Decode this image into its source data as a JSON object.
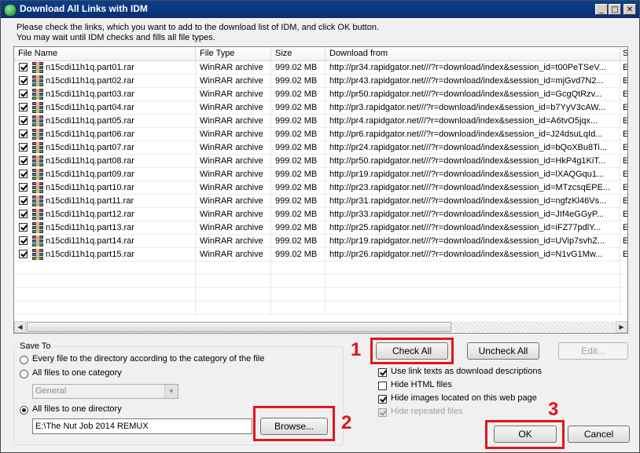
{
  "window": {
    "title": "Download All Links with IDM"
  },
  "instructions": [
    "Please check the links, which you want to add to the download list of IDM, and click OK button.",
    "You may wait until IDM checks and fills all file types."
  ],
  "columns": {
    "name": "File Name",
    "type": "File Type",
    "size": "Size",
    "from": "Download from",
    "extra": "S"
  },
  "files": [
    {
      "name": "n15cdi11h1q.part01.rar",
      "type": "WinRAR archive",
      "size": "999.02  MB",
      "url": "http://pr34.rapidgator.net///?r=download/index&session_id=t00PeTSeV...",
      "extra": "E"
    },
    {
      "name": "n15cdi11h1q.part02.rar",
      "type": "WinRAR archive",
      "size": "999.02  MB",
      "url": "http://pr43.rapidgator.net///?r=download/index&session_id=mjGvd7N2...",
      "extra": "E"
    },
    {
      "name": "n15cdi11h1q.part03.rar",
      "type": "WinRAR archive",
      "size": "999.02  MB",
      "url": "http://pr50.rapidgator.net///?r=download/index&session_id=GcgQtRzv...",
      "extra": "E"
    },
    {
      "name": "n15cdi11h1q.part04.rar",
      "type": "WinRAR archive",
      "size": "999.02  MB",
      "url": "http://pr3.rapidgator.net///?r=download/index&session_id=b7YyV3cAW...",
      "extra": "E"
    },
    {
      "name": "n15cdi11h1q.part05.rar",
      "type": "WinRAR archive",
      "size": "999.02  MB",
      "url": "http://pr4.rapidgator.net///?r=download/index&session_id=A6tvO5jqx...",
      "extra": "E"
    },
    {
      "name": "n15cdi11h1q.part06.rar",
      "type": "WinRAR archive",
      "size": "999.02  MB",
      "url": "http://pr6.rapidgator.net///?r=download/index&session_id=J24dsuLqId...",
      "extra": "E"
    },
    {
      "name": "n15cdi11h1q.part07.rar",
      "type": "WinRAR archive",
      "size": "999.02  MB",
      "url": "http://pr24.rapidgator.net///?r=download/index&session_id=bQoXBu8Ti...",
      "extra": "E"
    },
    {
      "name": "n15cdi11h1q.part08.rar",
      "type": "WinRAR archive",
      "size": "999.02  MB",
      "url": "http://pr50.rapidgator.net///?r=download/index&session_id=HkP4g1KiT...",
      "extra": "E"
    },
    {
      "name": "n15cdi11h1q.part09.rar",
      "type": "WinRAR archive",
      "size": "999.02  MB",
      "url": "http://pr19.rapidgator.net///?r=download/index&session_id=lXAQGqu1...",
      "extra": "E"
    },
    {
      "name": "n15cdi11h1q.part10.rar",
      "type": "WinRAR archive",
      "size": "999.02  MB",
      "url": "http://pr23.rapidgator.net///?r=download/index&session_id=MTzcsqEPE...",
      "extra": "E"
    },
    {
      "name": "n15cdi11h1q.part11.rar",
      "type": "WinRAR archive",
      "size": "999.02  MB",
      "url": "http://pr31.rapidgator.net///?r=download/index&session_id=ngfzKl46Vs...",
      "extra": "E"
    },
    {
      "name": "n15cdi11h1q.part12.rar",
      "type": "WinRAR archive",
      "size": "999.02  MB",
      "url": "http://pr33.rapidgator.net///?r=download/index&session_id=JIf4eGGyP...",
      "extra": "E"
    },
    {
      "name": "n15cdi11h1q.part13.rar",
      "type": "WinRAR archive",
      "size": "999.02  MB",
      "url": "http://pr25.rapidgator.net///?r=download/index&session_id=iFZ77pdlY...",
      "extra": "E"
    },
    {
      "name": "n15cdi11h1q.part14.rar",
      "type": "WinRAR archive",
      "size": "999.02  MB",
      "url": "http://pr19.rapidgator.net///?r=download/index&session_id=UVip7svhZ...",
      "extra": "E"
    },
    {
      "name": "n15cdi11h1q.part15.rar",
      "type": "WinRAR archive",
      "size": "999.02  MB",
      "url": "http://pr26.rapidgator.net///?r=download/index&session_id=N1vG1Mw...",
      "extra": "E"
    }
  ],
  "save_to": {
    "label": "Save To",
    "opt_every": "Every file to the directory according to the category of the file",
    "opt_category": "All files to one category",
    "category_value": "General",
    "opt_directory": "All files to one directory",
    "directory_value": "E:\\The Nut Job 2014 REMUX",
    "browse_label": "Browse..."
  },
  "buttons": {
    "check_all": "Check All",
    "uncheck_all": "Uncheck All",
    "edit": "Edit...",
    "ok": "OK",
    "cancel": "Cancel"
  },
  "options": {
    "use_link_texts": "Use link texts as download descriptions",
    "hide_html": "Hide HTML files",
    "hide_images": "Hide images located on this web page",
    "hide_repeated": "Hide repeated files"
  },
  "annotations": {
    "n1": "1",
    "n2": "2",
    "n3": "3"
  },
  "colors": {
    "highlight": "#e1151d",
    "titlebar": "#0b3f8e"
  }
}
